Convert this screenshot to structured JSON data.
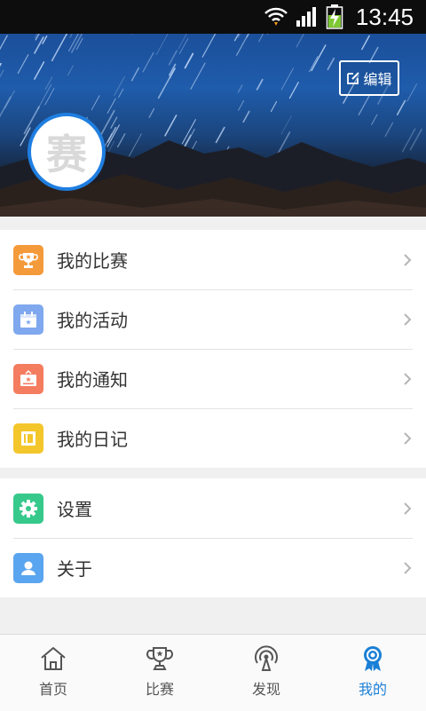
{
  "status_bar": {
    "time": "13:45"
  },
  "header": {
    "edit_label": "编辑",
    "avatar_text": "赛",
    "accent": "#1f7ee0"
  },
  "menu_group1": [
    {
      "label": "我的比赛",
      "icon": "trophy-icon",
      "color": "#f59a3b"
    },
    {
      "label": "我的活动",
      "icon": "calendar-icon",
      "color": "#7fa8ee"
    },
    {
      "label": "我的通知",
      "icon": "notice-board-icon",
      "color": "#f47c5f"
    },
    {
      "label": "我的日记",
      "icon": "diary-icon",
      "color": "#f3c62c"
    }
  ],
  "menu_group2": [
    {
      "label": "设置",
      "icon": "gear-icon",
      "color": "#36c98b"
    },
    {
      "label": "关于",
      "icon": "person-icon",
      "color": "#5aa5ef"
    }
  ],
  "tabs": [
    {
      "label": "首页",
      "icon": "home-icon",
      "active": false
    },
    {
      "label": "比赛",
      "icon": "trophy-icon",
      "active": false
    },
    {
      "label": "发现",
      "icon": "broadcast-icon",
      "active": false
    },
    {
      "label": "我的",
      "icon": "badge-icon",
      "active": true
    }
  ],
  "colors": {
    "active_tab": "#1a7fd6",
    "inactive_tab": "#555555"
  }
}
